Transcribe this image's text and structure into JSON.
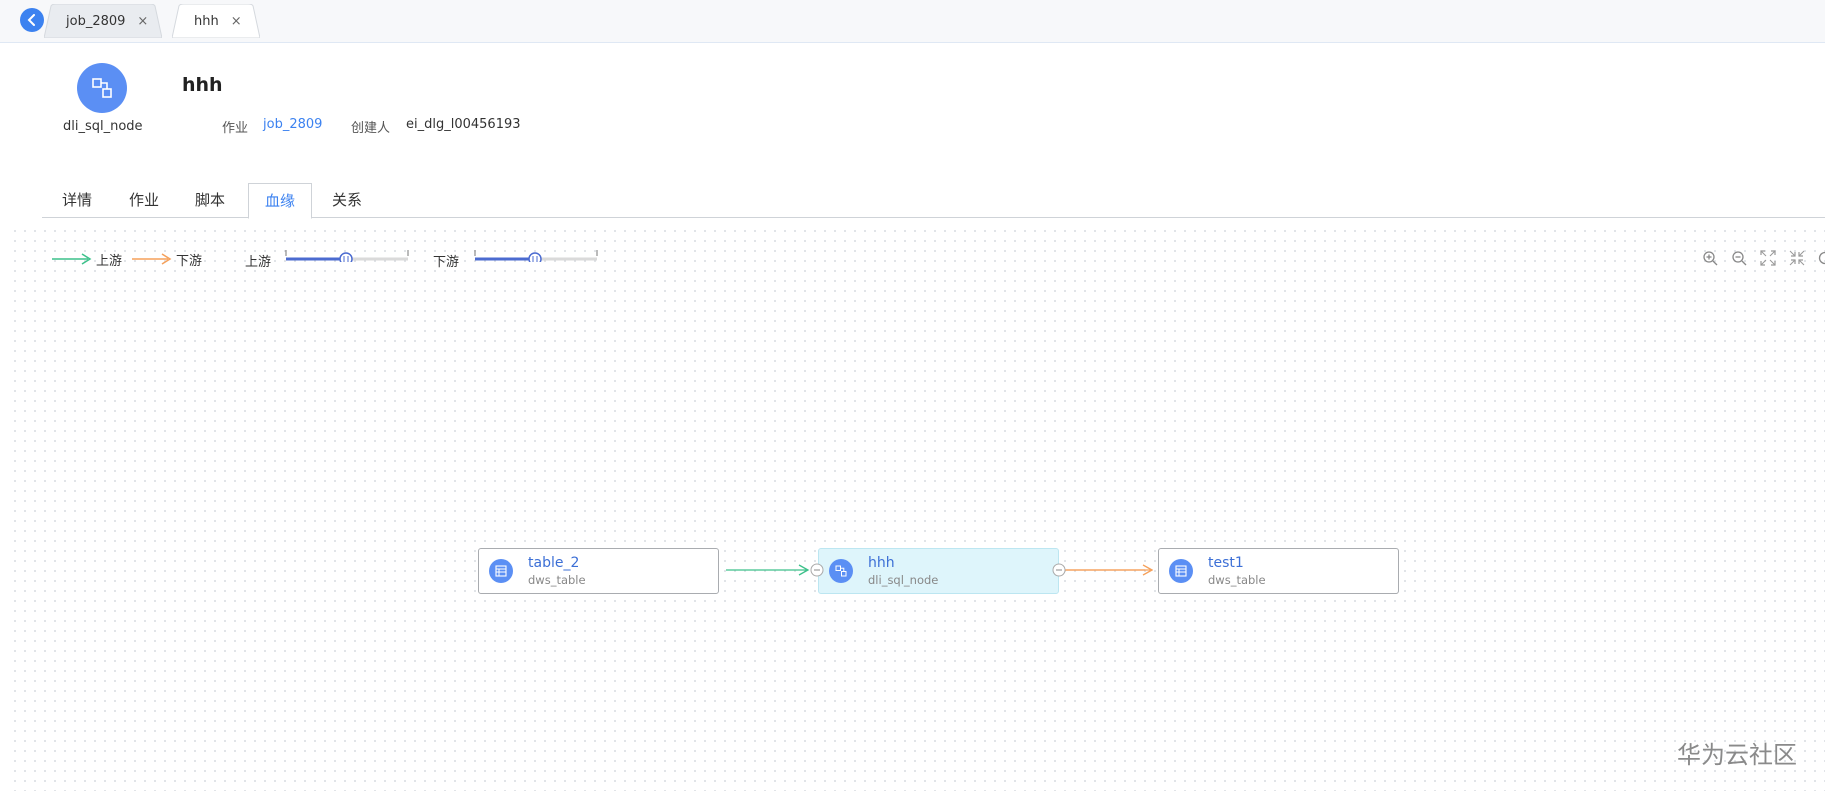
{
  "tabs": [
    {
      "label": "job_2809",
      "close": "×"
    },
    {
      "label": "hhh",
      "close": "×"
    }
  ],
  "header": {
    "title": "hhh",
    "node_type": "dli_sql_node",
    "job_label": "作业",
    "job_value": "job_2809",
    "creator_label": "创建人",
    "creator_value": "ei_dlg_l00456193"
  },
  "section_tabs": [
    "详情",
    "作业",
    "脚本",
    "血缘",
    "关系"
  ],
  "active_section_tab": "血缘",
  "lineage": {
    "legend": {
      "upstream": "上游",
      "downstream": "下游",
      "upstream_color": "#3cc18a",
      "downstream_color": "#f5a05a"
    },
    "sliders": [
      {
        "label": "上游",
        "value": 0.5
      },
      {
        "label": "下游",
        "value": 0.5
      }
    ],
    "nodes": [
      {
        "name": "table_2",
        "type": "dws_table",
        "icon": "table-icon"
      },
      {
        "name": "hhh",
        "type": "dli_sql_node",
        "icon": "node-icon"
      },
      {
        "name": "test1",
        "type": "dws_table",
        "icon": "table-icon"
      }
    ],
    "toolbar": [
      "zoom-in-icon",
      "zoom-out-icon",
      "fit-icon",
      "collapse-icon",
      "refresh-icon"
    ]
  },
  "watermark": "华为云社区",
  "colors": {
    "accent": "#3c82f0",
    "node_highlight": "#def5fb"
  }
}
